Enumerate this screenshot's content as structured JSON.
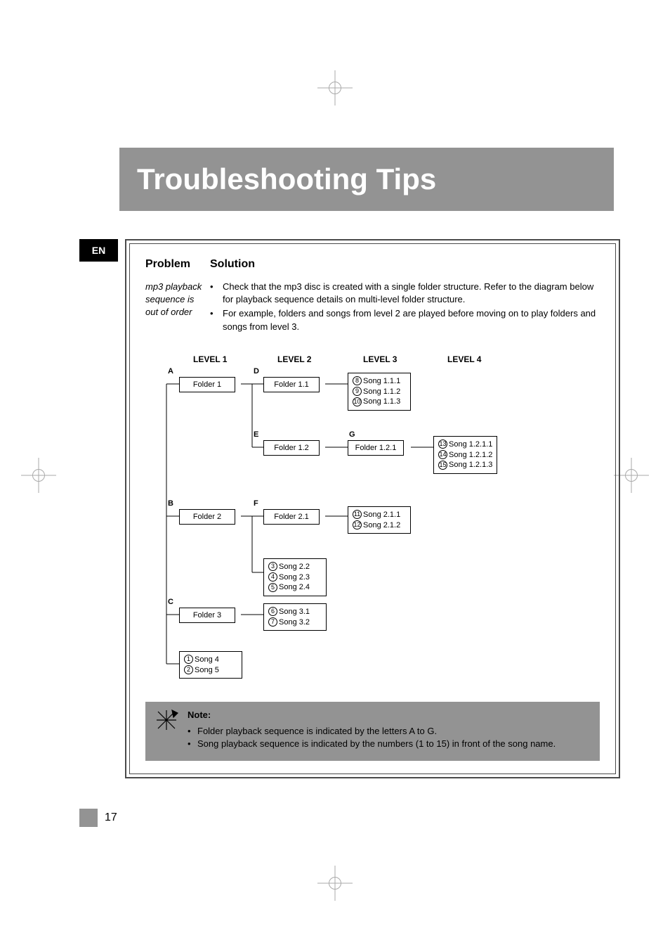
{
  "language_tab": "EN",
  "title": "Troubleshooting Tips",
  "headers": {
    "problem": "Problem",
    "solution": "Solution"
  },
  "row": {
    "problem": "mp3 playback sequence is out of order",
    "bullets": [
      "Check that the mp3 disc is created with a single folder structure. Refer to the diagram below for playback sequence details on multi-level folder structure.",
      "For example, folders and songs from level 2 are played before moving on to play folders and songs from level 3."
    ]
  },
  "levels": [
    "LEVEL 1",
    "LEVEL 2",
    "LEVEL 3",
    "LEVEL 4"
  ],
  "labels": {
    "A": "A",
    "B": "B",
    "C": "C",
    "D": "D",
    "E": "E",
    "F": "F",
    "G": "G"
  },
  "nodes": {
    "folder1": "Folder 1",
    "folder11": "Folder 1.1",
    "folder12": "Folder 1.2",
    "folder121": "Folder 1.2.1",
    "folder2": "Folder 2",
    "folder21": "Folder 2.1",
    "folder3": "Folder 3"
  },
  "songs": {
    "s111": [
      {
        "n": "8",
        "t": "Song 1.1.1"
      },
      {
        "n": "9",
        "t": "Song 1.1.2"
      },
      {
        "n": "10",
        "t": "Song 1.1.3"
      }
    ],
    "s1211": [
      {
        "n": "13",
        "t": "Song 1.2.1.1"
      },
      {
        "n": "14",
        "t": "Song 1.2.1.2"
      },
      {
        "n": "15",
        "t": "Song 1.2.1.3"
      }
    ],
    "s211": [
      {
        "n": "11",
        "t": "Song 2.1.1"
      },
      {
        "n": "12",
        "t": "Song 2.1.2"
      }
    ],
    "s22": [
      {
        "n": "3",
        "t": "Song 2.2"
      },
      {
        "n": "4",
        "t": "Song 2.3"
      },
      {
        "n": "5",
        "t": "Song 2.4"
      }
    ],
    "s31": [
      {
        "n": "6",
        "t": "Song 3.1"
      },
      {
        "n": "7",
        "t": "Song 3.2"
      }
    ],
    "s4": [
      {
        "n": "1",
        "t": "Song 4"
      },
      {
        "n": "2",
        "t": "Song 5"
      }
    ]
  },
  "note": {
    "title": "Note:",
    "lines": [
      "Folder playback sequence is indicated by the letters A to G.",
      "Song playback sequence is indicated by the numbers (1 to 15) in front of the song name."
    ]
  },
  "page_number": "17"
}
